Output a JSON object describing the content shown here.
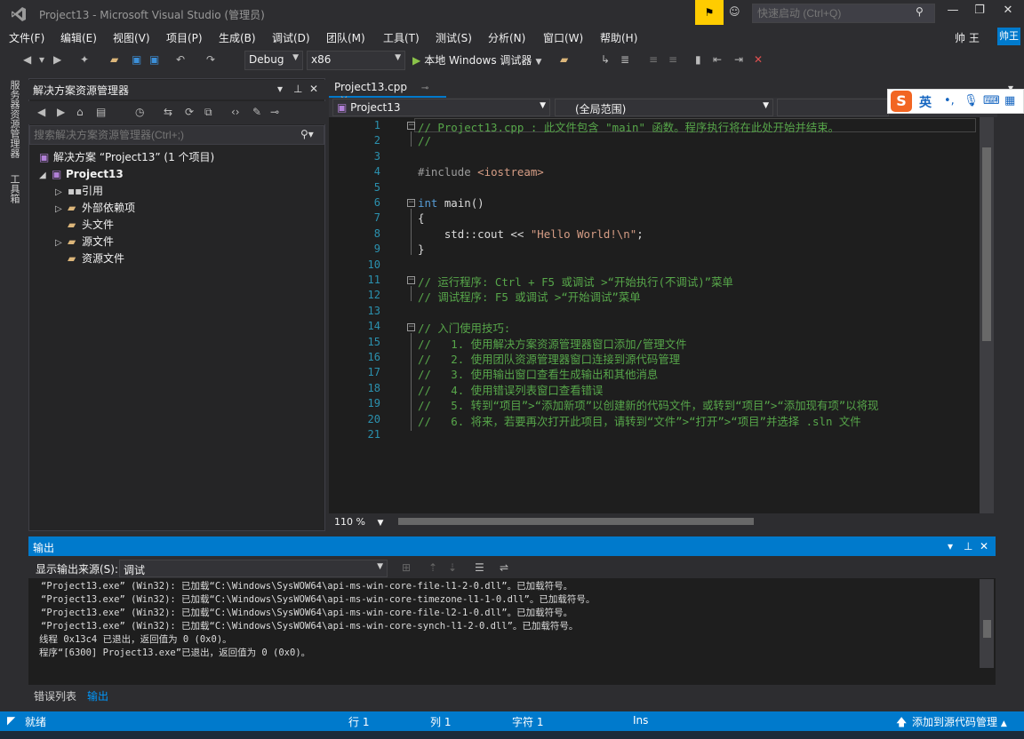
{
  "window": {
    "title": "Project13 - Microsoft Visual Studio (管理员)",
    "quick_launch_placeholder": "快速启动 (Ctrl+Q)",
    "user_name": "帅 王",
    "user_badge": "帅王"
  },
  "menu": [
    "文件(F)",
    "编辑(E)",
    "视图(V)",
    "项目(P)",
    "生成(B)",
    "调试(D)",
    "团队(M)",
    "工具(T)",
    "测试(S)",
    "分析(N)",
    "窗口(W)",
    "帮助(H)"
  ],
  "toolbar": {
    "config": "Debug",
    "platform": "x86",
    "start_label": "本地 Windows 调试器"
  },
  "side_tabs": [
    "服务器资源管理器",
    "工具箱"
  ],
  "solution_explorer": {
    "title": "解决方案资源管理器",
    "search_placeholder": "搜索解决方案资源管理器(Ctrl+;)",
    "tree": [
      {
        "label": "解决方案 “Project13” (1 个项目)"
      },
      {
        "label": "Project13"
      },
      {
        "label": "引用"
      },
      {
        "label": "外部依赖项"
      },
      {
        "label": "头文件"
      },
      {
        "label": "源文件"
      },
      {
        "label": "资源文件"
      }
    ]
  },
  "editor": {
    "tab": "Project13.cpp",
    "nav_project": "Project13",
    "nav_scope": "(全局范围)",
    "zoom": "110 %",
    "lines": [
      "// Project13.cpp : 此文件包含 \"main\" 函数。程序执行将在此处开始并结束。",
      "//",
      "",
      "#include <iostream>",
      "",
      "int main()",
      "{",
      "    std::cout << \"Hello World!\\n\";",
      "}",
      "",
      "// 运行程序: Ctrl + F5 或调试 >“开始执行(不调试)”菜单",
      "// 调试程序: F5 或调试 >“开始调试”菜单",
      "",
      "// 入门使用技巧:",
      "//   1. 使用解决方案资源管理器窗口添加/管理文件",
      "//   2. 使用团队资源管理器窗口连接到源代码管理",
      "//   3. 使用输出窗口查看生成输出和其他消息",
      "//   4. 使用错误列表窗口查看错误",
      "//   5. 转到“项目”>“添加新项”以创建新的代码文件，或转到“项目”>“添加现有项”以将现",
      "//   6. 将来，若要再次打开此项目，请转到“文件”>“打开”>“项目”并选择 .sln 文件",
      ""
    ]
  },
  "ime": {
    "lang": "英"
  },
  "output": {
    "title": "输出",
    "source_label": "显示输出来源(S):",
    "source_value": "调试",
    "lines": [
      "“Project13.exe” (Win32): 已加载“C:\\Windows\\SysWOW64\\api-ms-win-core-file-l1-2-0.dll”。已加载符号。",
      "“Project13.exe” (Win32): 已加载“C:\\Windows\\SysWOW64\\api-ms-win-core-timezone-l1-1-0.dll”。已加载符号。",
      "“Project13.exe” (Win32): 已加载“C:\\Windows\\SysWOW64\\api-ms-win-core-file-l2-1-0.dll”。已加载符号。",
      "“Project13.exe” (Win32): 已加载“C:\\Windows\\SysWOW64\\api-ms-win-core-synch-l1-2-0.dll”。已加载符号。",
      "线程 0x13c4 已退出，返回值为 0 (0x0)。",
      "程序“[6300] Project13.exe”已退出，返回值为 0 (0x0)。"
    ]
  },
  "bottom_tabs": [
    "错误列表",
    "输出"
  ],
  "status": {
    "ready": "就绪",
    "line": "行 1",
    "col": "列 1",
    "char": "字符 1",
    "mode": "Ins",
    "source_control": "添加到源代码管理"
  }
}
